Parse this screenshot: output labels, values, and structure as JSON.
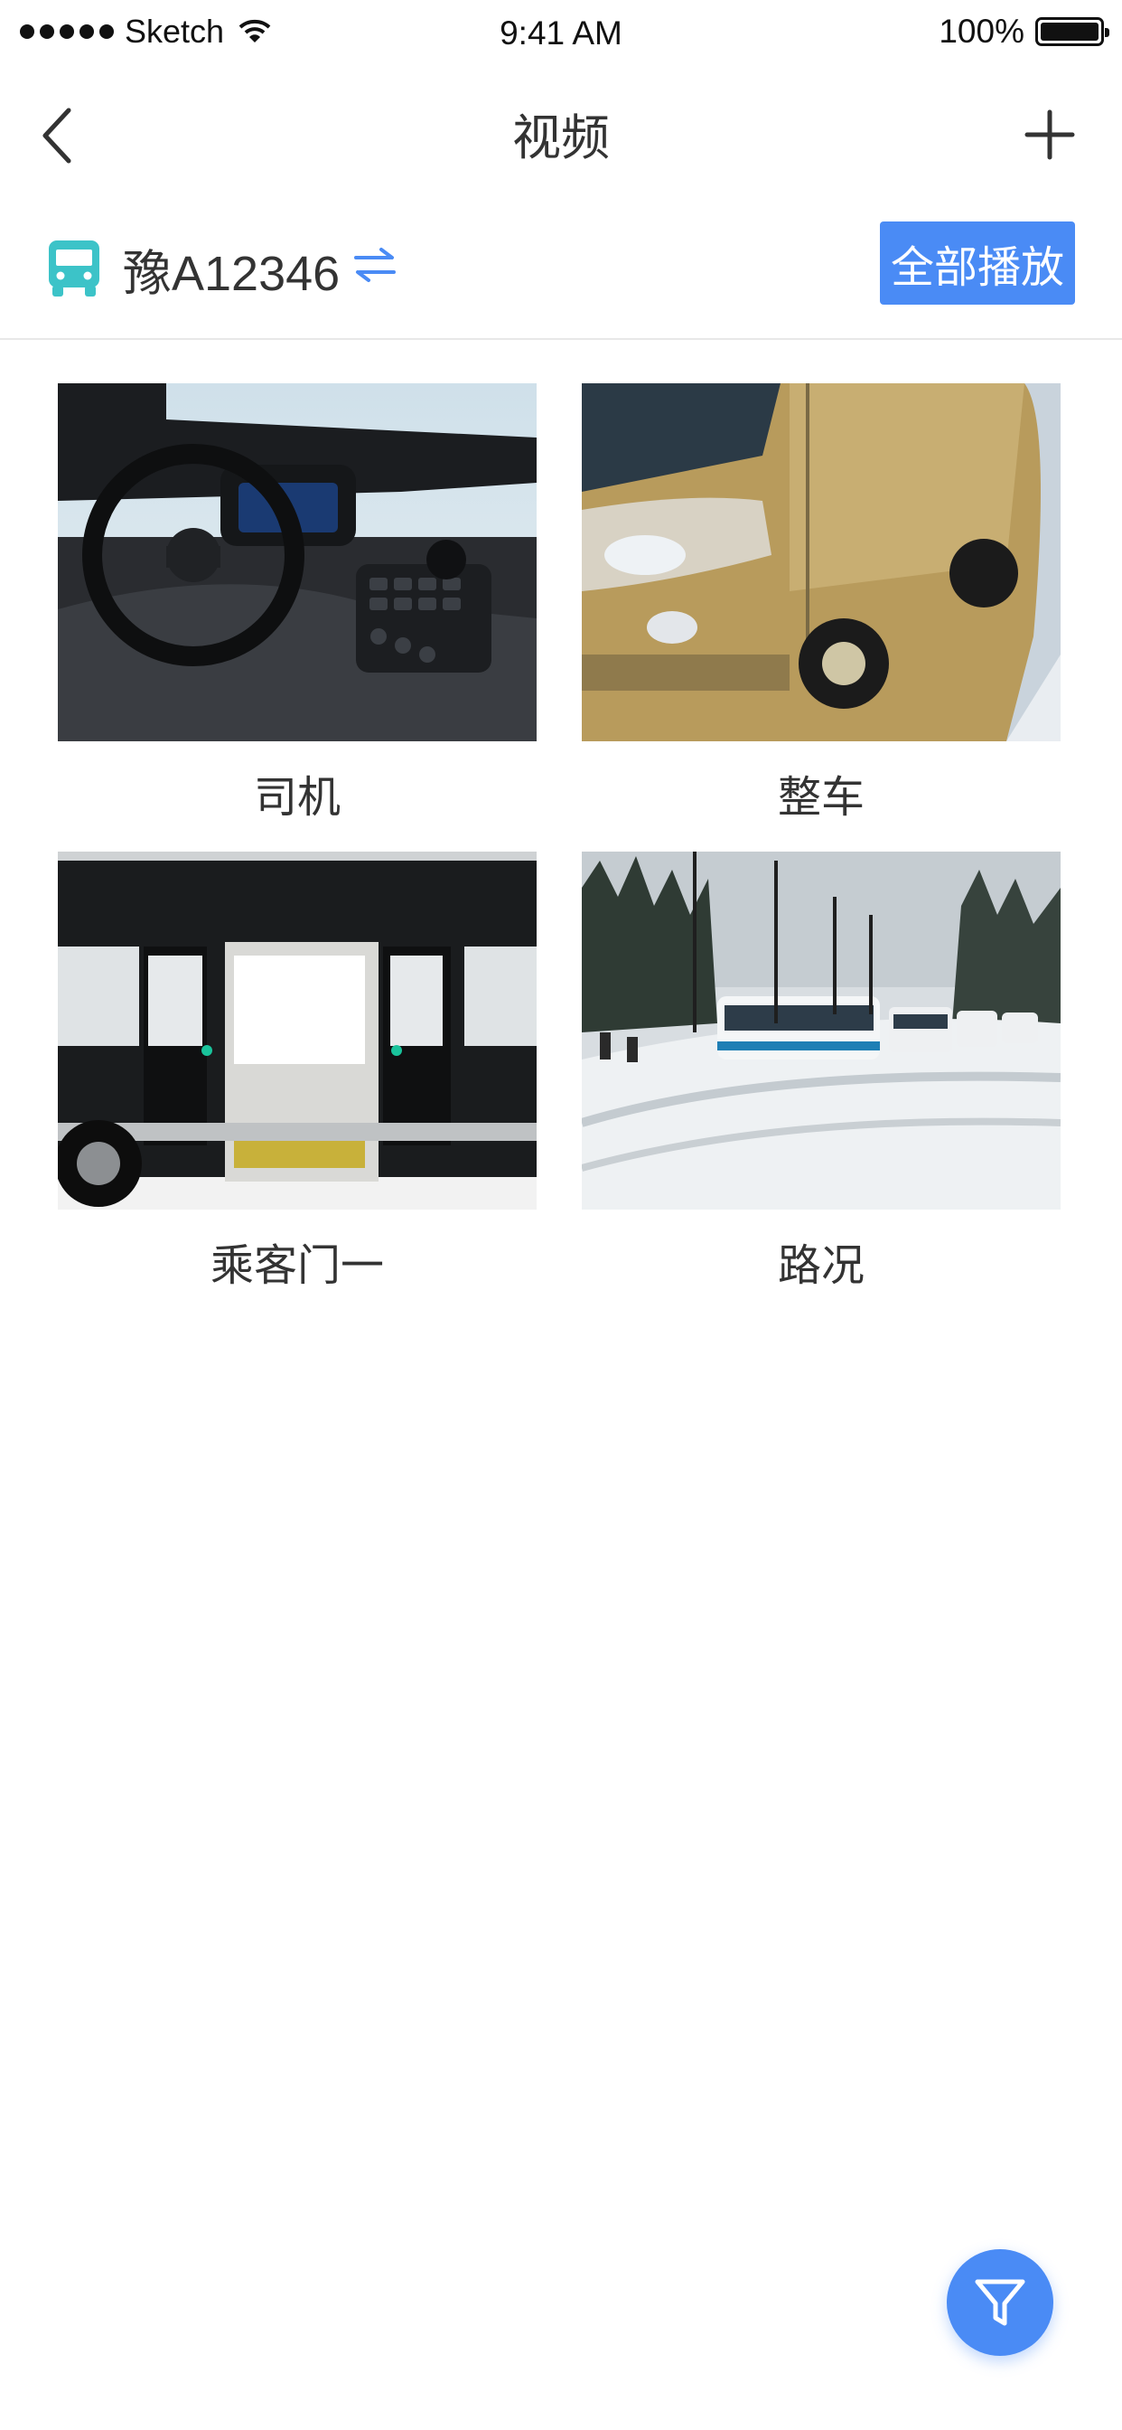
{
  "status_bar": {
    "carrier": "Sketch",
    "time": "9:41 AM",
    "battery": "100%"
  },
  "nav": {
    "title": "视频",
    "back_icon": "chevron-left-icon",
    "add_icon": "plus-icon"
  },
  "vehicle": {
    "plate": "豫A12346",
    "bus_icon": "bus-icon",
    "swap_icon": "swap-icon",
    "play_all_label": "全部播放"
  },
  "cameras": [
    {
      "label": "司机"
    },
    {
      "label": "整车"
    },
    {
      "label": "乘客门一"
    },
    {
      "label": "路况"
    }
  ],
  "colors": {
    "accent": "#4A8BF5",
    "bus_icon": "#3CC3C8"
  },
  "fab": {
    "icon": "filter-icon"
  }
}
